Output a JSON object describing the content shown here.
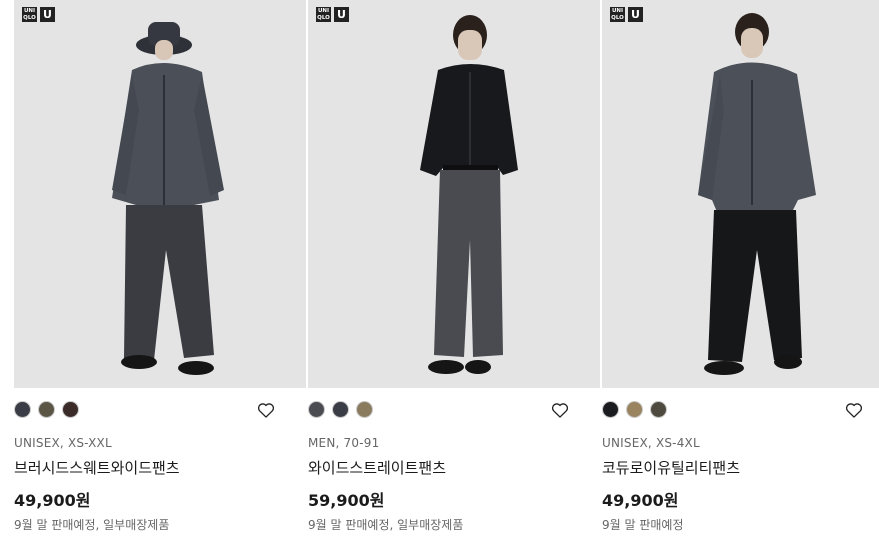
{
  "products": [
    {
      "logo": {
        "top": "UNI QLO",
        "badge": "U"
      },
      "colors": [
        "#3a3d45",
        "#5a5545",
        "#3b2b28"
      ],
      "meta": "UNISEX, XS-XXL",
      "name": "브러시드스웨트와이드팬츠",
      "price": "49,900원",
      "note": "9월 말 판매예정, 일부매장제품"
    },
    {
      "logo": {
        "top": "UNI QLO",
        "badge": "U"
      },
      "colors": [
        "#4a4c52",
        "#3a3d45",
        "#8a7a5e"
      ],
      "meta": "MEN, 70-91",
      "name": "와이드스트레이트팬츠",
      "price": "59,900원",
      "note": "9월 말 판매예정, 일부매장제품"
    },
    {
      "logo": {
        "top": "UNI QLO",
        "badge": "U"
      },
      "colors": [
        "#1b1c20",
        "#9a8460",
        "#4f4a40"
      ],
      "meta": "UNISEX, XS-4XL",
      "name": "코듀로이유틸리티팬츠",
      "price": "49,900원",
      "note": "9월 말 판매예정"
    }
  ]
}
